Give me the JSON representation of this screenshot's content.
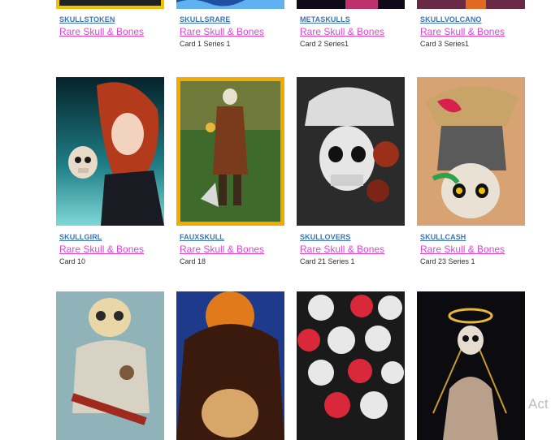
{
  "rows": [
    {
      "cards": [
        {
          "name": "SKULLSTOKEN",
          "collection": "Rare Skull & Bones",
          "subtitle": ""
        },
        {
          "name": "SKULLSRARE",
          "collection": "Rare Skull & Bones",
          "subtitle": "Card 1 Series 1"
        },
        {
          "name": "METASKULLS",
          "collection": "Rare Skull & Bones",
          "subtitle": "Card 2 Series1"
        },
        {
          "name": "SKULLVOLCANO",
          "collection": "Rare Skull & Bones",
          "subtitle": "Card 3 Series1"
        }
      ]
    },
    {
      "cards": [
        {
          "name": "SKULLGIRL",
          "collection": "Rare Skull & Bones",
          "subtitle": "Card 10"
        },
        {
          "name": "FAUXSKULL",
          "collection": "Rare Skull & Bones",
          "subtitle": "Card 18"
        },
        {
          "name": "SKULLOVERS",
          "collection": "Rare Skull & Bones",
          "subtitle": "Card 21 Series 1"
        },
        {
          "name": "SKULLCASH",
          "collection": "Rare Skull & Bones",
          "subtitle": "Card 23 Series 1"
        }
      ]
    },
    {
      "cards": [
        {
          "name": "",
          "collection": "",
          "subtitle": ""
        },
        {
          "name": "",
          "collection": "",
          "subtitle": ""
        },
        {
          "name": "",
          "collection": "",
          "subtitle": ""
        },
        {
          "name": "",
          "collection": "",
          "subtitle": ""
        }
      ]
    }
  ],
  "watermark": "Act",
  "colors": {
    "name_link": "#3a73b8",
    "collection_link": "#e63fd8",
    "frame_gold": "#f2a900"
  }
}
